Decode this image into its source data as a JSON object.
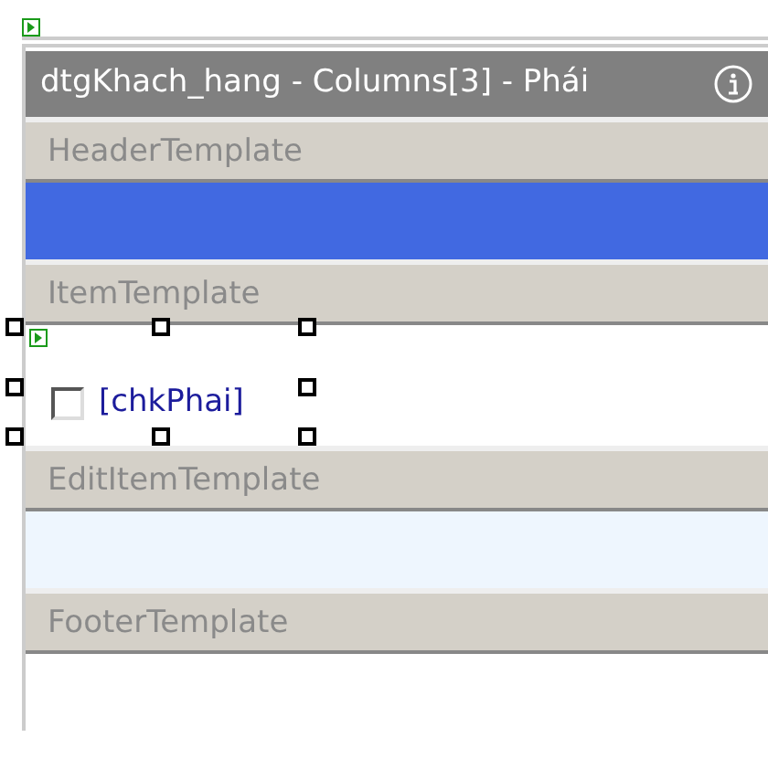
{
  "window": {
    "title": "dtgKhach_hang - Columns[3] - Phái"
  },
  "templates": [
    {
      "label": "HeaderTemplate",
      "color": "#4169e1",
      "kind": "empty"
    },
    {
      "label": "ItemTemplate",
      "color": "#ffffff",
      "kind": "checkbox",
      "control": {
        "text": "[chkPhai]",
        "checked": false,
        "selected": true
      }
    },
    {
      "label": "EditItemTemplate",
      "color": "#eef6fe",
      "kind": "empty"
    },
    {
      "label": "FooterTemplate",
      "color": "#ffffff",
      "kind": "empty"
    }
  ]
}
